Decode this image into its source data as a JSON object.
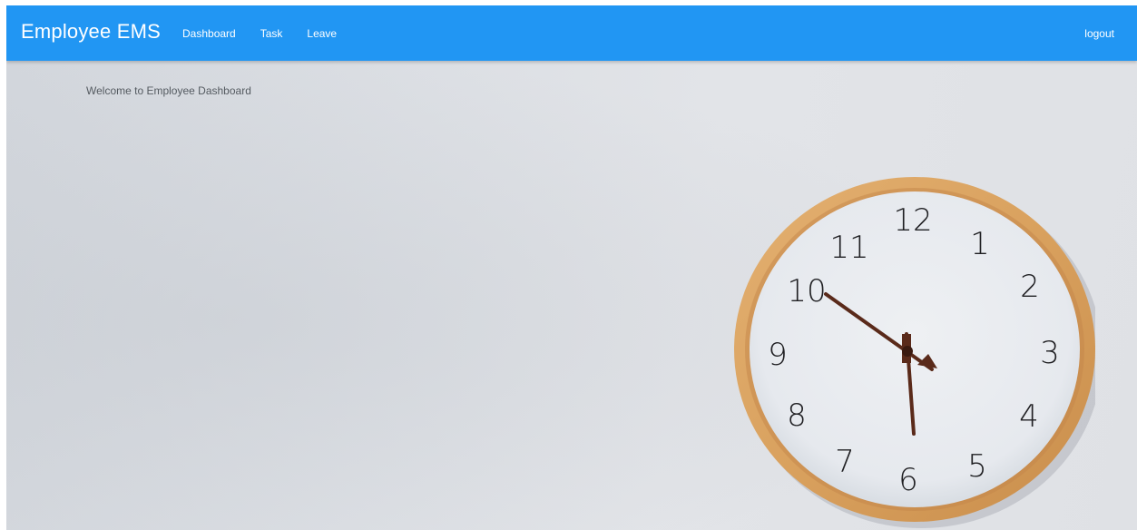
{
  "navbar": {
    "brand": "Employee EMS",
    "links": [
      {
        "label": "Dashboard"
      },
      {
        "label": "Task"
      },
      {
        "label": "Leave"
      }
    ],
    "logout_label": "logout",
    "color": "#2196f3"
  },
  "main": {
    "welcome_text": "Welcome to Employee Dashboard"
  },
  "background_image": {
    "subject": "wall clock",
    "clock_numbers": [
      "12",
      "1",
      "2",
      "3",
      "4",
      "5",
      "6",
      "7",
      "8",
      "9",
      "10",
      "11"
    ],
    "frame_color": "#d9a15e",
    "hand_color": "#5a2a1a"
  }
}
